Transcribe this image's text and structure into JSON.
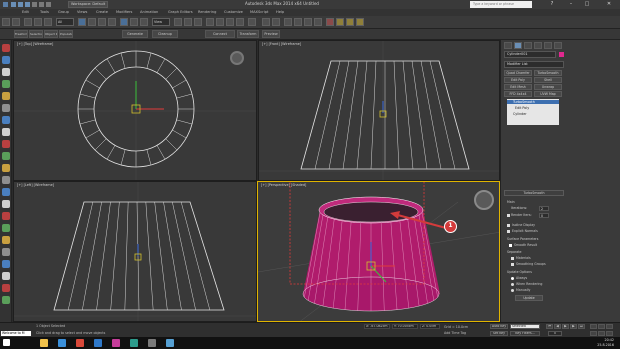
{
  "window": {
    "app_title": "Autodesk 3ds Max  2014 x64    Untitled",
    "workspace": "Workspace: Default",
    "search_placeholder": "Type a keyword or phrase"
  },
  "menu": [
    "Edit",
    "Tools",
    "Group",
    "Views",
    "Create",
    "Modifiers",
    "Animation",
    "Graph Editors",
    "Rendering",
    "Customize",
    "MAXScript",
    "Help"
  ],
  "ribbon": {
    "tabs": [
      "Freeform",
      "Selection",
      "Object Paint",
      "Populate"
    ],
    "buttons": [
      "Generate",
      "Cleanup",
      "Connect",
      "Transform",
      "Preview"
    ]
  },
  "toolbar": {
    "filter": "All",
    "view": "View"
  },
  "viewports": {
    "top": "[+] [Top] [Wireframe]",
    "front": "[+] [Front] [Wireframe]",
    "left": "[+] [Left] [Wireframe]",
    "perspective": "[+] [Perspective] [Shaded]"
  },
  "callout": {
    "number": "1"
  },
  "command_panel": {
    "object_name": "Cylinder001",
    "modifier_list": "Modifier List",
    "buttons": [
      "Quad Chamfer",
      "TurboSmooth",
      "Edit Poly",
      "Shell",
      "Edit Mesh",
      "Unwrap",
      "FFD 4x4x4",
      "UVW Map"
    ],
    "stack": [
      "TurboSmooth",
      "Edit Poly",
      "Cylinder"
    ],
    "rollout_title": "TurboSmooth",
    "main": "Main",
    "iterations_label": "Iterations:",
    "iterations": "2",
    "render_iters_label": "Render Iters:",
    "render_iters": "0",
    "isoline_display": "Isoline Display",
    "explicit_normals": "Explicit Normals",
    "surface_params": "Surface Parameters",
    "smooth_result": "Smooth Result",
    "separate": "Separate",
    "materials": "Materials",
    "smoothing_groups": "Smoothing Groups",
    "update_options": "Update Options",
    "always": "Always",
    "when_rendering": "When Rendering",
    "manually": "Manually",
    "update": "Update"
  },
  "status": {
    "maxscript": "Welcome to M",
    "selected": "1 Object Selected",
    "prompt": "Click and drag to select and move objects",
    "x": "X: -67.082cm",
    "y": "Y: 70.005cm",
    "z": "Z: 0.0cm",
    "grid": "Grid = 10.0cm",
    "add_time_tag": "Add Time Tag",
    "auto_key": "Auto Key",
    "selected_dropdown": "Selected",
    "set_key": "Set Key",
    "key_filters": "Key Filters...",
    "frame": "0"
  },
  "taskbar": {
    "time": "20:42",
    "date": "25.8.2016"
  },
  "colors": {
    "pink_object": "#e0288f",
    "selection_red": "#e23a3a",
    "callout_red": "#d33b3b",
    "viewport_active": "#e0b400"
  }
}
